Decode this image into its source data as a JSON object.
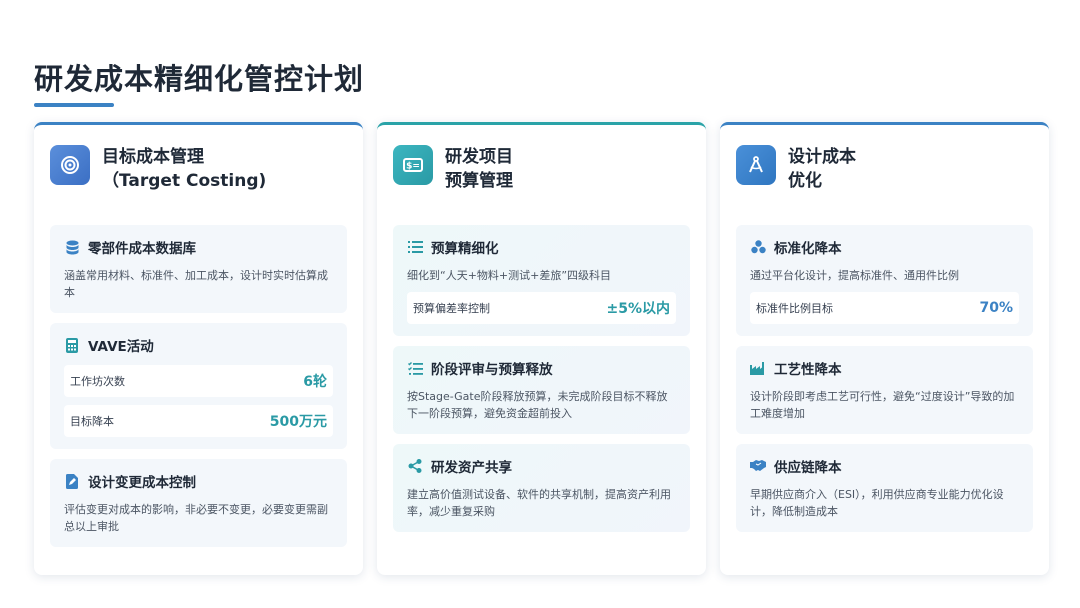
{
  "title": "研发成本精细化管控计划",
  "colors": {
    "accent_blue": "#3b82c4",
    "accent_teal": "#2aa3a8",
    "value_teal": "#2a9aa5"
  },
  "columns": [
    {
      "title_line1": "目标成本管理",
      "title_line2": "（Target Costing)",
      "icon": "target-icon",
      "cards": [
        {
          "icon": "database-icon",
          "title": "零部件成本数据库",
          "desc": "涵盖常用材料、标准件、加工成本，设计时实时估算成本"
        },
        {
          "icon": "calculator-icon",
          "title": "VAVE活动",
          "metrics": [
            {
              "label": "工作坊次数",
              "value": "6轮"
            },
            {
              "label": "目标降本",
              "value": "500万元"
            }
          ]
        },
        {
          "icon": "document-edit-icon",
          "title": "设计变更成本控制",
          "desc": "评估变更对成本的影响，非必要不变更，必要变更需副总以上审批"
        }
      ]
    },
    {
      "title_line1": "研发项目",
      "title_line2": "预算管理",
      "icon": "money-icon",
      "cards": [
        {
          "icon": "list-icon",
          "title": "预算精细化",
          "desc": "细化到“人天+物料+测试+差旅”四级科目",
          "metrics": [
            {
              "label": "预算偏差率控制",
              "value": "±5%以内"
            }
          ]
        },
        {
          "icon": "checklist-icon",
          "title": "阶段评审与预算释放",
          "desc": "按Stage-Gate阶段释放预算，未完成阶段目标不释放下一阶段预算，避免资金超前投入"
        },
        {
          "icon": "share-icon",
          "title": "研发资产共享",
          "desc": "建立高价值测试设备、软件的共享机制，提高资产利用率，减少重复采购"
        }
      ]
    },
    {
      "title_line1": "设计成本",
      "title_line2": "优化",
      "icon": "drafting-compass-icon",
      "cards": [
        {
          "icon": "cubes-icon",
          "title": "标准化降本",
          "desc": "通过平台化设计，提高标准件、通用件比例",
          "metrics": [
            {
              "label": "标准件比例目标",
              "value": "70%"
            }
          ]
        },
        {
          "icon": "industry-icon",
          "title": "工艺性降本",
          "desc": "设计阶段即考虑工艺可行性，避免“过度设计”导致的加工难度增加"
        },
        {
          "icon": "handshake-icon",
          "title": "供应链降本",
          "desc": "早期供应商介入（ESI），利用供应商专业能力优化设计，降低制造成本"
        }
      ]
    }
  ]
}
